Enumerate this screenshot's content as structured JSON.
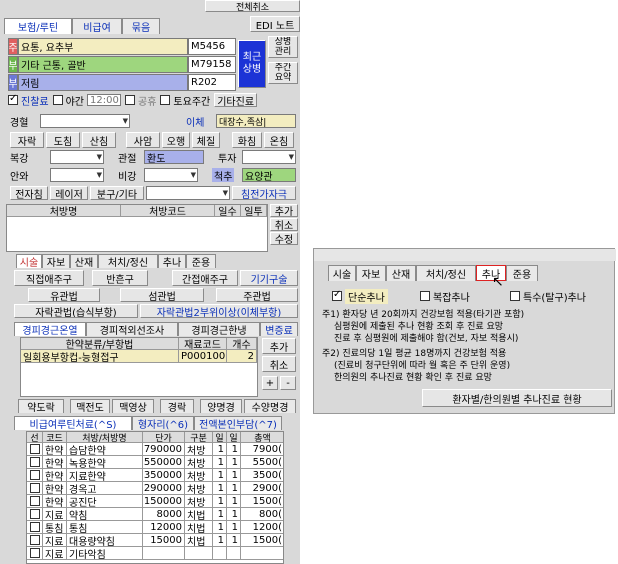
{
  "left": {
    "top_title": "전체취소",
    "top_tabs": [
      "보험/루틴",
      "비급여",
      "묶음"
    ],
    "edi_button": "EDI 노트",
    "diagnoses": [
      {
        "tag": "주",
        "name": "요통, 요추부",
        "code": "M5456"
      },
      {
        "tag": "부",
        "name": "기타 근통, 골반",
        "code": "M79158"
      },
      {
        "tag": "부",
        "name": "저림",
        "code": "R202"
      }
    ],
    "recent_button": "최근\n상병",
    "disease_mgmt": "상병\n관리",
    "main_complaint": "주간\n요약",
    "visit_checks": {
      "first_visit": "진찰료",
      "night": "야간",
      "time": "12:00",
      "holiday": "공휴",
      "sat": "토요주간",
      "other": "기타진료"
    },
    "symptom_rows": [
      [
        "경혈",
        "",
        "이체",
        "대장수,족삼|"
      ],
      [
        "자락",
        "도침",
        "산침",
        "사암",
        "오행",
        "체질",
        "화침",
        "온침"
      ],
      [
        "복강",
        "",
        "관절",
        "환도",
        "",
        "투자",
        ""
      ],
      [
        "안와",
        "",
        "비강",
        "",
        "척추",
        "요양관"
      ],
      [
        "전자침",
        "레이저",
        "분구/기타",
        "",
        "침전가자극"
      ]
    ],
    "rx_headers": [
      "처방명",
      "처방코드",
      "일수",
      "일투",
      "추가"
    ],
    "rx_buttons": [
      "취소",
      "수정"
    ],
    "mid_tabs": [
      "시술",
      "자보",
      "산재",
      "처치/정신",
      "추나",
      "준용"
    ],
    "mid_buttons": [
      [
        "직접애주구",
        "반흔구",
        "간접애주구",
        "기기구술"
      ],
      [
        "유관법",
        "섬관법",
        "주관법"
      ],
      [
        "자락관법(습식부항)",
        "자락관법2부위이상(이체부항)"
      ]
    ],
    "proc_tabs": [
      "경피경근온열",
      "경피적외선조사",
      "경피경근한냉",
      "변증료"
    ],
    "proc_headers": [
      "한약분류/부항법",
      "재료코드",
      "개수",
      "추가"
    ],
    "proc_row": {
      "name": "일회용부항컵-능형접구",
      "code": "P000100",
      "count": "2"
    },
    "proc_buttons": [
      "취소",
      "+",
      "-"
    ],
    "lower_tabs": [
      "약도락",
      "맥전도",
      "맥영상",
      "경락",
      "양명경",
      "수양명경"
    ],
    "noncov_tabs": [
      "비급여루틴처료(^S)",
      "형자리(^6)",
      "전액본인부담(^7)"
    ],
    "table_headers": [
      "선",
      "코드",
      "처방/처방명",
      "단가",
      "구분",
      "일",
      "일",
      "총액"
    ],
    "table_rows": [
      [
        "한약",
        "습담한약",
        "790000",
        "처방",
        "1",
        "1",
        "7900("
      ],
      [
        "한약",
        "녹용한약",
        "550000",
        "처방",
        "1",
        "1",
        "5500("
      ],
      [
        "한약",
        "지료한약",
        "350000",
        "처방",
        "1",
        "1",
        "3500("
      ],
      [
        "한약",
        "경옥고",
        "290000",
        "처방",
        "1",
        "1",
        "2900("
      ],
      [
        "한약",
        "공진단",
        "150000",
        "처방",
        "1",
        "1",
        "1500("
      ],
      [
        "지료",
        "약침",
        "8000",
        "치법",
        "1",
        "1",
        "800("
      ],
      [
        "통침",
        "통침",
        "12000",
        "치법",
        "1",
        "1",
        "1200("
      ],
      [
        "지료",
        "대용량약침",
        "15000",
        "치법",
        "1",
        "1",
        "1500("
      ],
      [
        "지료",
        "기타악침",
        "",
        "",
        "",
        "",
        ""
      ]
    ]
  },
  "right": {
    "tabs": [
      "시술",
      "자보",
      "산재",
      "처치/정신",
      "추나",
      "준용"
    ],
    "options": [
      {
        "label": "단순추나",
        "checked": true
      },
      {
        "label": "복잡추나",
        "checked": false
      },
      {
        "label": "특수(탈구)추나",
        "checked": false
      }
    ],
    "notes": [
      "주1) 환자당 년 20회까지 건강보험 적용(타기관 포함)",
      "심평원에 제출된 추나 현황 조회 후 진료 요망",
      "진료 후 심평원에 제출해야 함(건보, 자보 적용시)",
      "주2) 진료의당 1일 평균 18명까지 건강보험 적용",
      "(진료비 청구단위에 따라 월 혹은 주 단위 운영)",
      "한의원의 추나진료 현황 확인 후 진료 요망"
    ],
    "bottom_button": "환자별/한의원별 추나진료 현황"
  }
}
